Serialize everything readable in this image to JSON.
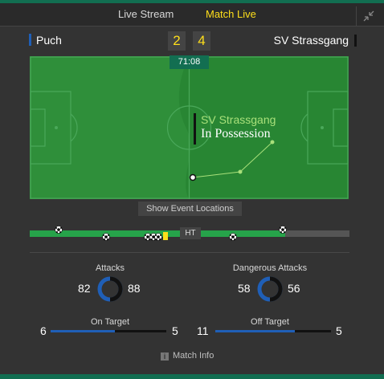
{
  "tabs": {
    "live_stream": "Live Stream",
    "match_live": "Match Live"
  },
  "match": {
    "home_team": "Puch",
    "away_team": "SV Strassgang",
    "home_score": "2",
    "away_score": "4",
    "clock": "71:08",
    "home_color": "#1f5fb7",
    "away_color": "#111111"
  },
  "possession": {
    "team": "SV Strassgang",
    "label": "In Possession"
  },
  "show_events_label": "Show Event Locations",
  "timeline": {
    "ht_label": "HT",
    "progress_fraction": 0.8
  },
  "stats": {
    "attacks": {
      "title": "Attacks",
      "home": "82",
      "away": "88"
    },
    "dangerous_attacks": {
      "title": "Dangerous Attacks",
      "home": "58",
      "away": "56"
    },
    "on_target": {
      "title": "On Target",
      "home": "6",
      "away": "5"
    },
    "off_target": {
      "title": "Off Target",
      "home": "11",
      "away": "5"
    }
  },
  "match_info_label": "Match Info"
}
